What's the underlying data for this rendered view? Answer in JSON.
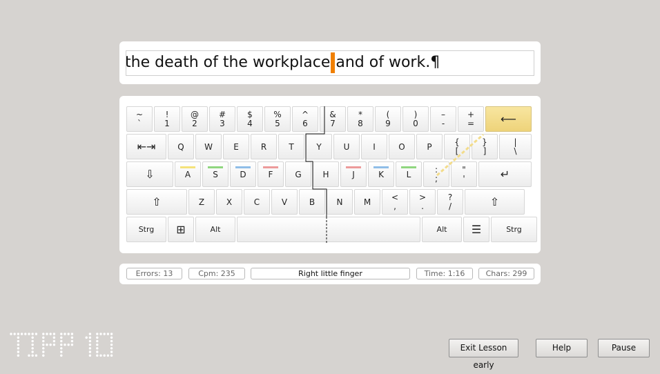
{
  "text_display": {
    "before_cursor": "the death of the workplace",
    "after_cursor": "and of work.¶"
  },
  "keyboard": {
    "row1": [
      {
        "top": "~",
        "bot": "`"
      },
      {
        "top": "!",
        "bot": "1"
      },
      {
        "top": "@",
        "bot": "2"
      },
      {
        "top": "#",
        "bot": "3"
      },
      {
        "top": "$",
        "bot": "4"
      },
      {
        "top": "%",
        "bot": "5"
      },
      {
        "top": "^",
        "bot": "6"
      },
      {
        "top": "&",
        "bot": "7"
      },
      {
        "top": "*",
        "bot": "8"
      },
      {
        "top": "(",
        "bot": "9"
      },
      {
        "top": ")",
        "bot": "0"
      },
      {
        "top": "–",
        "bot": "-"
      },
      {
        "top": "+",
        "bot": "="
      },
      {
        "label": "⟵",
        "name": "backspace-key"
      }
    ],
    "row2": [
      {
        "label": "⇤⇥",
        "name": "tab-key"
      },
      {
        "label": "Q"
      },
      {
        "label": "W"
      },
      {
        "label": "E"
      },
      {
        "label": "R"
      },
      {
        "label": "T"
      },
      {
        "label": "Y"
      },
      {
        "label": "U"
      },
      {
        "label": "I"
      },
      {
        "label": "O"
      },
      {
        "label": "P"
      },
      {
        "top": "{",
        "bot": "["
      },
      {
        "top": "}",
        "bot": "]"
      },
      {
        "top": "|",
        "bot": "\\"
      }
    ],
    "row3": [
      {
        "label": "⇩",
        "name": "caps-lock-key"
      },
      {
        "label": "A"
      },
      {
        "label": "S"
      },
      {
        "label": "D"
      },
      {
        "label": "F"
      },
      {
        "label": "G"
      },
      {
        "label": "H"
      },
      {
        "label": "J"
      },
      {
        "label": "K"
      },
      {
        "label": "L"
      },
      {
        "top": ":",
        "bot": ";"
      },
      {
        "top": "\"",
        "bot": "'"
      },
      {
        "label": "↵",
        "name": "enter-key"
      }
    ],
    "row4": [
      {
        "label": "⇧",
        "name": "left-shift-key"
      },
      {
        "label": "Z"
      },
      {
        "label": "X"
      },
      {
        "label": "C"
      },
      {
        "label": "V"
      },
      {
        "label": "B"
      },
      {
        "label": "N"
      },
      {
        "label": "M"
      },
      {
        "top": "<",
        "bot": ","
      },
      {
        "top": ">",
        "bot": "."
      },
      {
        "top": "?",
        "bot": "/"
      },
      {
        "label": "⇧",
        "name": "right-shift-key"
      }
    ],
    "row5": [
      {
        "label": "Strg",
        "name": "left-ctrl-key"
      },
      {
        "label": "⊞",
        "name": "windows-key"
      },
      {
        "label": "Alt",
        "name": "left-alt-key"
      },
      {
        "label": "",
        "name": "space-key"
      },
      {
        "label": "Alt",
        "name": "right-alt-key"
      },
      {
        "label": "☰",
        "name": "menu-key"
      },
      {
        "label": "Strg",
        "name": "right-ctrl-key"
      }
    ],
    "finger_colors": {
      "little": "#f5e27a",
      "ring": "#8fd67f",
      "middle": "#8fbde8",
      "index": "#ec9a9a"
    },
    "active_key": "backspace-key"
  },
  "status": {
    "errors": "Errors: 13",
    "cpm": "Cpm: 235",
    "finger": "Right little finger",
    "time": "Time: 1:16",
    "chars": "Chars: 299"
  },
  "logo_text": "TIPP 10",
  "buttons": {
    "exit": "Exit Lesson early",
    "help": "Help",
    "pause": "Pause"
  }
}
